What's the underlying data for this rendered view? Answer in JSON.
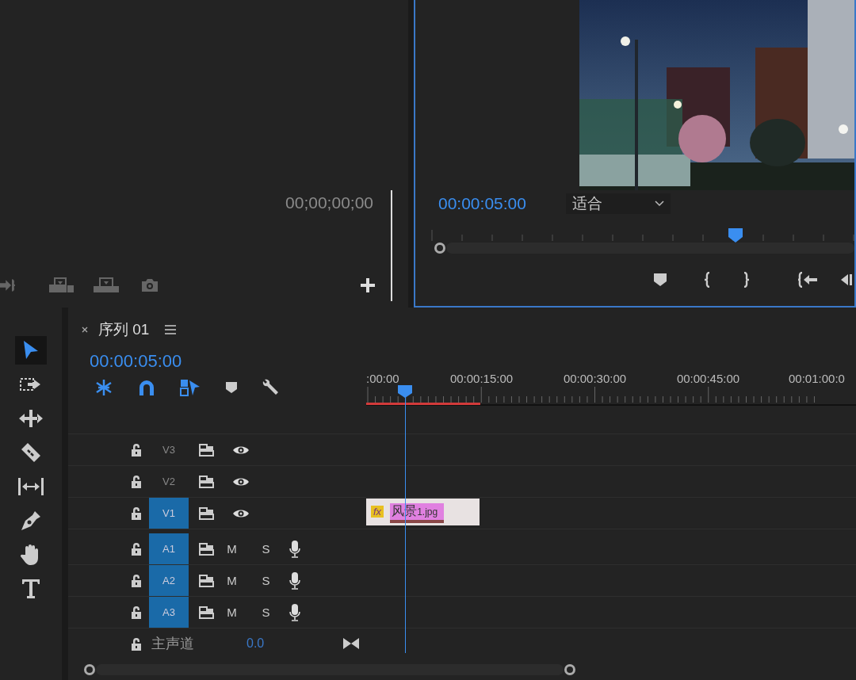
{
  "source_monitor": {
    "timecode": "00;00;00;00"
  },
  "program_monitor": {
    "timecode": "00:00:05:00",
    "zoom": "适合",
    "playhead": {
      "level": 0.72
    }
  },
  "tools": [
    {
      "kind": "selection",
      "selected": true
    },
    {
      "kind": "track-select",
      "selected": false
    },
    {
      "kind": "ripple",
      "selected": false
    },
    {
      "kind": "razor",
      "selected": false
    },
    {
      "kind": "slip",
      "selected": false
    },
    {
      "kind": "pen",
      "selected": false
    },
    {
      "kind": "hand",
      "selected": false
    },
    {
      "kind": "type",
      "selected": false
    }
  ],
  "timeline": {
    "tab_title": "序列 01",
    "timecode": "00:00:05:00",
    "toggles": [
      {
        "kind": "nest",
        "on": true
      },
      {
        "kind": "snap",
        "on": true
      },
      {
        "kind": "linked",
        "on": true
      },
      {
        "kind": "marker",
        "on": false
      },
      {
        "kind": "settings",
        "on": false
      }
    ],
    "ruler_labels": [
      ":00:00",
      "00:00:15:00",
      "00:00:30:00",
      "00:00:45:00",
      "00:01:00:0"
    ],
    "tracks": [
      {
        "label": "V3",
        "kind": "video",
        "targeted": false
      },
      {
        "label": "V2",
        "kind": "video",
        "targeted": false
      },
      {
        "label": "V1",
        "kind": "video",
        "targeted": true
      },
      {
        "label": "A1",
        "kind": "audio",
        "targeted": true,
        "mute": "M",
        "solo": "S"
      },
      {
        "label": "A2",
        "kind": "audio",
        "targeted": true,
        "mute": "M",
        "solo": "S"
      },
      {
        "label": "A3",
        "kind": "audio",
        "targeted": true,
        "mute": "M",
        "solo": "S"
      }
    ],
    "clip": {
      "fx": "fx",
      "name": "风景",
      "suffix": "1.jpg"
    },
    "master": {
      "label": "主声道",
      "value": "0.0"
    }
  }
}
